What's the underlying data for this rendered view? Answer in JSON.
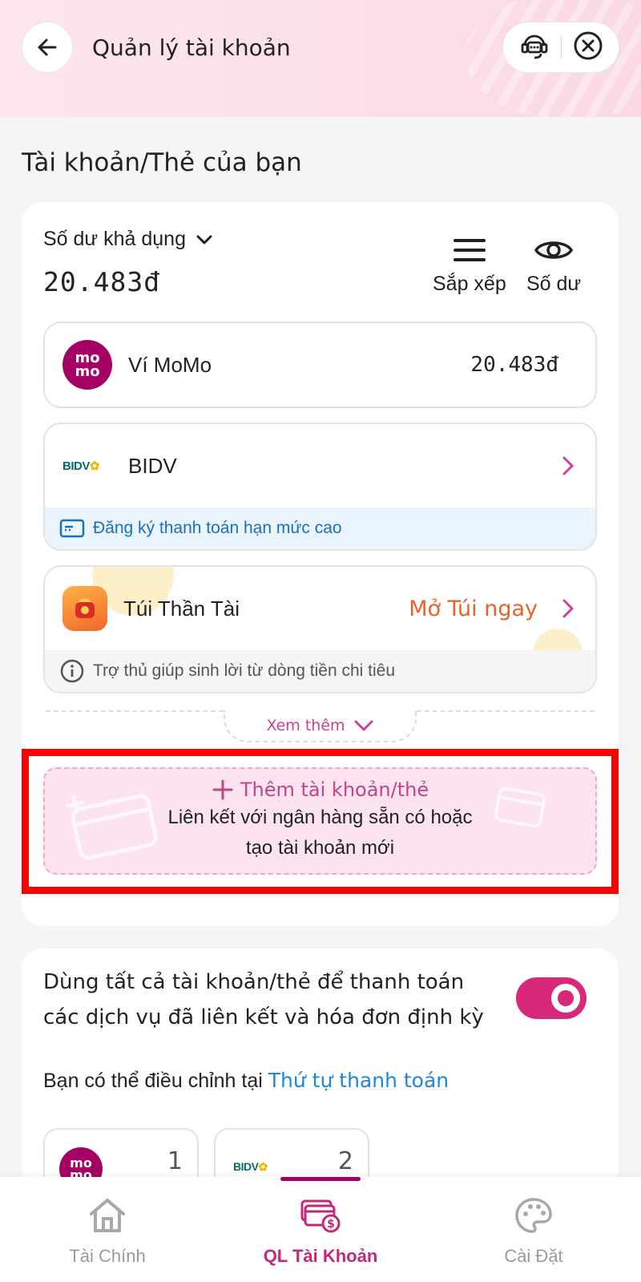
{
  "header": {
    "title": "Quản lý tài khoản",
    "back_icon": "back-arrow-icon",
    "support_icon": "support-chat-icon",
    "close_icon": "close-icon"
  },
  "section_title": "Tài khoản/Thẻ của bạn",
  "balance": {
    "label": "Số dư khả dụng",
    "value": "20.483đ",
    "sort_label": "Sắp xếp",
    "toggle_label": "Số dư"
  },
  "accounts": [
    {
      "name": "Ví MoMo",
      "amount": "20.483đ",
      "logo": "MoMo"
    },
    {
      "name": "BIDV",
      "logo": "BIDV",
      "strip_text": "Đăng ký thanh toán hạn mức cao"
    },
    {
      "name": "Túi Thần Tài",
      "cta": "Mở Túi ngay",
      "strip_text": "Trợ thủ giúp sinh lời từ dòng tiền chi tiêu"
    }
  ],
  "see_more": "Xem thêm",
  "add_account": {
    "title": "Thêm tài khoản/thẻ",
    "desc_line1": "Liên kết với ngân hàng sẵn có hoặc",
    "desc_line2": "tạo tài khoản mới"
  },
  "payment": {
    "text_line1": "Dùng tất cả tài khoản/thẻ để thanh toán",
    "text_line2": "các dịch vụ đã liên kết và hóa đơn định kỳ",
    "toggle_on": true,
    "adjust_prefix": "Bạn có thể điều chỉnh tại",
    "adjust_link": "Thứ tự thanh toán",
    "order": [
      {
        "logo": "MoMo",
        "num": "1"
      },
      {
        "logo": "BIDV",
        "num": "2"
      }
    ]
  },
  "bottom_nav": [
    {
      "label": "Tài Chính",
      "icon": "home-icon",
      "active": false
    },
    {
      "label": "QL Tài Khoản",
      "icon": "cards-money-icon",
      "active": true
    },
    {
      "label": "Cài Đặt",
      "icon": "palette-icon",
      "active": false
    }
  ],
  "colors": {
    "brand": "#a50064",
    "accent_pink": "#d8287a",
    "link_blue": "#1c88d8",
    "cta_orange": "#e8622a",
    "highlight_red": "#ff0000"
  }
}
